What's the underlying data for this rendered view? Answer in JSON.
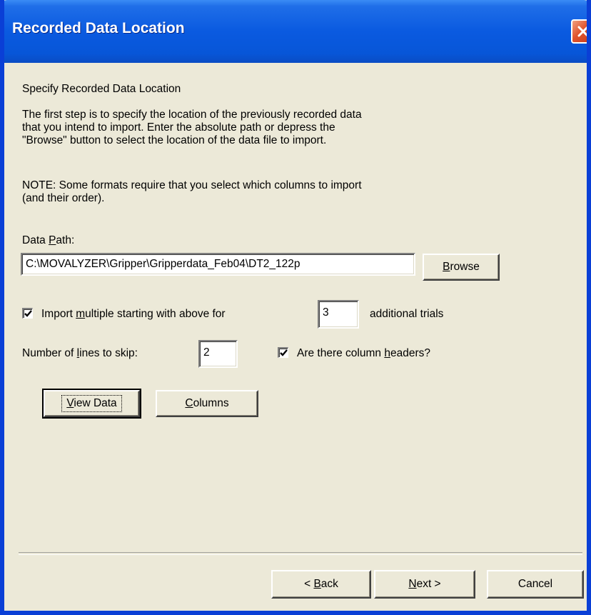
{
  "window": {
    "title": "Recorded Data Location"
  },
  "page": {
    "heading": "Specify Recorded Data Location",
    "description": "The first step is to specify the location of the previously recorded data\nthat you intend to import. Enter the absolute path or depress the\n\"Browse\" button to select the location of the data file to import.",
    "note": "NOTE: Some formats require that you select which columns to import\n(and their order)."
  },
  "data_path": {
    "label_before": "Data ",
    "label_mnemonic": "P",
    "label_after": "ath:",
    "value": "C:\\MOVALYZER\\Gripper\\Gripperdata_Feb04\\DT2_122p"
  },
  "browse_button": {
    "mnemonic": "B",
    "rest": "rowse"
  },
  "import_multiple": {
    "checked": true,
    "label_before": "Import ",
    "label_mnemonic": "m",
    "label_after": "ultiple starting with above  for",
    "value": "3",
    "suffix": "additional trials"
  },
  "lines_to_skip": {
    "label_before": "Number of ",
    "label_mnemonic": "l",
    "label_after": "ines to skip:",
    "value": "2"
  },
  "column_headers": {
    "checked": true,
    "label_before": "Are there column ",
    "label_mnemonic": "h",
    "label_after": "eaders?"
  },
  "view_data_button": {
    "mnemonic": "V",
    "rest": "iew Data"
  },
  "columns_button": {
    "mnemonic": "C",
    "rest": "olumns"
  },
  "footer": {
    "back": {
      "prefix": "< ",
      "mnemonic": "B",
      "rest": "ack"
    },
    "next": {
      "mnemonic": "N",
      "rest": "ext >"
    },
    "cancel": {
      "label": "Cancel"
    }
  },
  "icons": {
    "close": "close-icon",
    "checkmark": "checkmark-icon"
  },
  "colors": {
    "titlebar": "#0a5ae0",
    "dialog_bg": "#ece9d8",
    "close_button": "#e0542c"
  }
}
